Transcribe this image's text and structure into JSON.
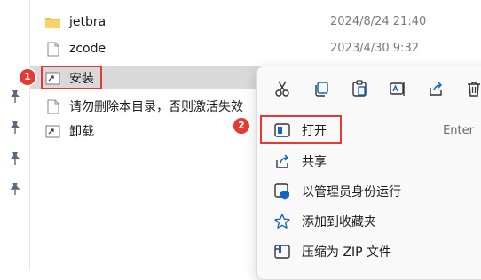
{
  "files": [
    {
      "name": "jetbra",
      "date": "2024/8/24 21:40",
      "type": "folder"
    },
    {
      "name": "zcode",
      "date": "2023/4/30 9:32",
      "type": "file"
    },
    {
      "name": "安装",
      "date": "",
      "type": "shortcut",
      "selected": true
    },
    {
      "name": "请勿删除本目录，否则激活失效",
      "date": "",
      "type": "file"
    },
    {
      "name": "卸载",
      "date": "",
      "type": "shortcut"
    }
  ],
  "badges": {
    "first": "1",
    "second": "2"
  },
  "context_menu": {
    "toolbar": [
      "cut-icon",
      "copy-icon",
      "paste-icon",
      "rename-icon",
      "share-icon",
      "delete-icon"
    ],
    "items": [
      {
        "label": "打开",
        "shortcut": "Enter",
        "icon": "open-icon"
      },
      {
        "label": "共享",
        "icon": "share-icon"
      },
      {
        "label": "以管理员身份运行",
        "icon": "admin-shield-icon"
      },
      {
        "label": "添加到收藏夹",
        "icon": "star-icon"
      },
      {
        "label": "压缩为 ZIP 文件",
        "icon": "zip-icon"
      }
    ]
  },
  "colors": {
    "accent": "#1565c0",
    "highlight": "#e53935",
    "folder": "#f4c542"
  }
}
